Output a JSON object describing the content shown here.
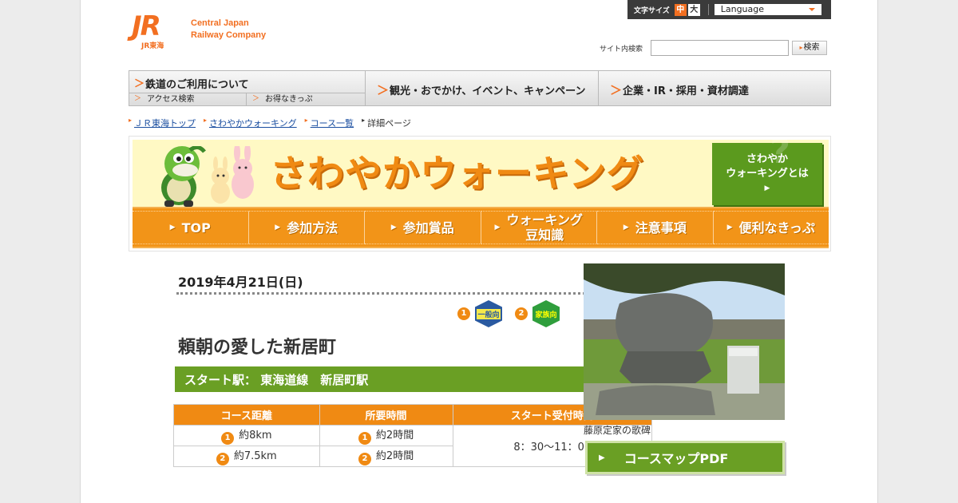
{
  "header": {
    "logo_mark": "JR",
    "logo_sub": "JR東海",
    "company_line1": "Central Japan",
    "company_line2": "Railway Company",
    "font_size_label": "文字サイズ",
    "font_size_mid": "中",
    "font_size_big": "大",
    "language_label": "Language",
    "search_label": "サイト内検索",
    "search_value": "",
    "search_button": "検索"
  },
  "global_nav": {
    "rail_title": "鉄道のご利用について",
    "rail_sub1": "アクセス検索",
    "rail_sub2": "お得なきっぷ",
    "tour": "観光・おでかけ、イベント、キャンペーン",
    "corp": "企業・IR・採用・資材調達"
  },
  "breadcrumb": {
    "items": [
      "ＪＲ東海トップ",
      "さわやかウォーキング",
      "コース一覧"
    ],
    "current": "詳細ページ"
  },
  "banner": {
    "title": "さわやかウォーキング",
    "about_line1": "さわやか",
    "about_line2": "ウォーキングとは",
    "menu": [
      "TOP",
      "参加方法",
      "参加賞品",
      "ウォーキング",
      "豆知識",
      "注意事項",
      "便利なきっぷ"
    ]
  },
  "course": {
    "date": "2019年4月21日(日)",
    "badge1_num": "1",
    "badge1_label": "一般向",
    "badge2_num": "2",
    "badge2_label": "家族向",
    "title": "頼朝の愛した新居町",
    "start": "スタート駅：  東海道線　新居町駅",
    "table": {
      "h_distance": "コース距離",
      "h_time": "所要時間",
      "h_reception": "スタート受付時間",
      "row1_num": "1",
      "row1_distance": "約8km",
      "row1_time": "約2時間",
      "row2_num": "2",
      "row2_distance": "約7.5km",
      "row2_time": "約2時間",
      "reception": "8：30～11：00"
    },
    "photo_caption": "藤原定家の歌碑",
    "pdf_button": "コースマップPDF"
  },
  "colors": {
    "accent": "#f26f21",
    "banner_orange": "#f29418",
    "green": "#6a9f24"
  }
}
